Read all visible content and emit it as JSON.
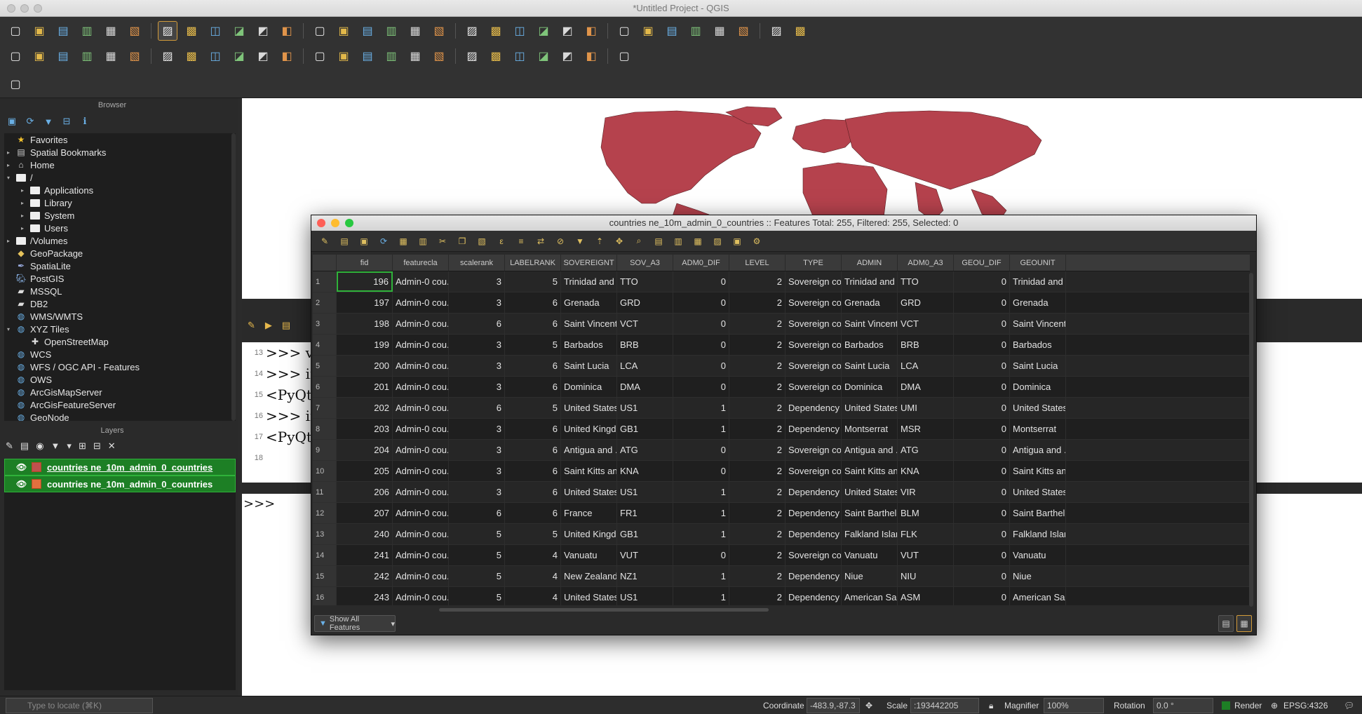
{
  "window": {
    "title": "*Untitled Project - QGIS"
  },
  "toolbar": {
    "row1": [
      "new-project-icon",
      "open-project-icon",
      "save-project-icon",
      "save-as-icon",
      "print-layout-icon",
      "style-manager-icon",
      "pan-icon",
      "pan-to-selection-icon",
      "zoom-in-icon",
      "zoom-out-icon",
      "zoom-full-icon",
      "zoom-to-selection-icon",
      "zoom-to-layer-icon",
      "zoom-native-icon",
      "zoom-last-icon",
      "zoom-next-icon",
      "new-map-view-icon",
      "temporal-icon",
      "bookmark-icon",
      "refresh-icon",
      "identify-icon",
      "actions-icon",
      "select-icon",
      "deselect-icon",
      "attribute-table-icon",
      "field-calc-icon",
      "statistics-icon",
      "processing-icon",
      "sum-icon",
      "measure-icon",
      "annotation-icon",
      "text-annotation-icon"
    ],
    "row2": [
      "add-vector-icon",
      "add-raster-icon",
      "digitize-icon",
      "edit-pencil-icon",
      "save-edits-icon",
      "add-polygon-icon",
      "vertex-tool-icon",
      "delete-icon",
      "cut-icon",
      "copy-icon",
      "paste-icon",
      "undo-icon",
      "redo-icon",
      "label-icon",
      "diagram-icon",
      "label-pin-icon",
      "label-show-icon",
      "label-move-icon",
      "label-rotate-icon",
      "label-change-icon",
      "globe-icon",
      "wms-icon",
      "plugin-icon",
      "python-icon",
      "help-icon"
    ],
    "row3": [
      "gps-icon"
    ]
  },
  "browser": {
    "title": "Browser",
    "items": [
      {
        "label": "Favorites",
        "icon": "star-icon",
        "depth": 0,
        "arrow": ""
      },
      {
        "label": "Spatial Bookmarks",
        "icon": "bookmark-icon",
        "depth": 0,
        "arrow": "▸"
      },
      {
        "label": "Home",
        "icon": "home-icon",
        "depth": 0,
        "arrow": "▸"
      },
      {
        "label": "/",
        "icon": "folder-icon",
        "depth": 0,
        "arrow": "▾"
      },
      {
        "label": "Applications",
        "icon": "folder-icon",
        "depth": 1,
        "arrow": "▸"
      },
      {
        "label": "Library",
        "icon": "folder-icon",
        "depth": 1,
        "arrow": "▸"
      },
      {
        "label": "System",
        "icon": "folder-icon",
        "depth": 1,
        "arrow": "▸"
      },
      {
        "label": "Users",
        "icon": "folder-icon",
        "depth": 1,
        "arrow": "▸"
      },
      {
        "label": "/Volumes",
        "icon": "folder-icon",
        "depth": 0,
        "arrow": "▸"
      },
      {
        "label": "GeoPackage",
        "icon": "geopackage-icon",
        "depth": 0,
        "arrow": ""
      },
      {
        "label": "SpatiaLite",
        "icon": "spatialite-icon",
        "depth": 0,
        "arrow": ""
      },
      {
        "label": "PostGIS",
        "icon": "postgis-icon",
        "depth": 0,
        "arrow": ""
      },
      {
        "label": "MSSQL",
        "icon": "mssql-icon",
        "depth": 0,
        "arrow": ""
      },
      {
        "label": "DB2",
        "icon": "db2-icon",
        "depth": 0,
        "arrow": ""
      },
      {
        "label": "WMS/WMTS",
        "icon": "wms-icon",
        "depth": 0,
        "arrow": ""
      },
      {
        "label": "XYZ Tiles",
        "icon": "xyz-icon",
        "depth": 0,
        "arrow": "▾"
      },
      {
        "label": "OpenStreetMap",
        "icon": "tile-icon",
        "depth": 1,
        "arrow": ""
      },
      {
        "label": "WCS",
        "icon": "wcs-icon",
        "depth": 0,
        "arrow": ""
      },
      {
        "label": "WFS / OGC API - Features",
        "icon": "wfs-icon",
        "depth": 0,
        "arrow": ""
      },
      {
        "label": "OWS",
        "icon": "ows-icon",
        "depth": 0,
        "arrow": ""
      },
      {
        "label": "ArcGisMapServer",
        "icon": "arcgis-icon",
        "depth": 0,
        "arrow": ""
      },
      {
        "label": "ArcGisFeatureServer",
        "icon": "arcgis-icon",
        "depth": 0,
        "arrow": ""
      },
      {
        "label": "GeoNode",
        "icon": "geonode-icon",
        "depth": 0,
        "arrow": ""
      }
    ]
  },
  "layers": {
    "title": "Layers",
    "items": [
      {
        "label": "countries ne_10m_admin_0_countries",
        "symbol": "#c0504e",
        "underline": true
      },
      {
        "label": "countries ne_10m_admin_0_countries",
        "symbol": "#e2703e",
        "underline": false
      }
    ]
  },
  "console": {
    "lines": [
      {
        "no": "13",
        "text": ">>> vla"
      },
      {
        "no": "14",
        "text": ">>> ifa"
      },
      {
        "no": "15",
        "text": "<PyQt5"
      },
      {
        "no": "16",
        "text": ">>> ifa"
      },
      {
        "no": "17",
        "text": "<PyQt5"
      },
      {
        "no": "18",
        "text": ""
      }
    ],
    "prompt": ">>>"
  },
  "attribute_table": {
    "title": "countries ne_10m_admin_0_countries :: Features Total: 255, Filtered: 255, Selected: 0",
    "columns": [
      "fid",
      "featurecla",
      "scalerank",
      "LABELRANK",
      "SOVEREIGNT",
      "SOV_A3",
      "ADM0_DIF",
      "LEVEL",
      "TYPE",
      "ADMIN",
      "ADM0_A3",
      "GEOU_DIF",
      "GEOUNIT"
    ],
    "rows": [
      [
        "1",
        "196",
        "Admin-0 cou...",
        "3",
        "5",
        "Trinidad and ...",
        "TTO",
        "0",
        "2",
        "Sovereign co...",
        "Trinidad and ...",
        "TTO",
        "0",
        "Trinidad and ..."
      ],
      [
        "2",
        "197",
        "Admin-0 cou...",
        "3",
        "6",
        "Grenada",
        "GRD",
        "0",
        "2",
        "Sovereign co...",
        "Grenada",
        "GRD",
        "0",
        "Grenada"
      ],
      [
        "3",
        "198",
        "Admin-0 cou...",
        "6",
        "6",
        "Saint Vincent ...",
        "VCT",
        "0",
        "2",
        "Sovereign co...",
        "Saint Vincent ...",
        "VCT",
        "0",
        "Saint Vincent ..."
      ],
      [
        "4",
        "199",
        "Admin-0 cou...",
        "3",
        "5",
        "Barbados",
        "BRB",
        "0",
        "2",
        "Sovereign co...",
        "Barbados",
        "BRB",
        "0",
        "Barbados"
      ],
      [
        "5",
        "200",
        "Admin-0 cou...",
        "3",
        "6",
        "Saint Lucia",
        "LCA",
        "0",
        "2",
        "Sovereign co...",
        "Saint Lucia",
        "LCA",
        "0",
        "Saint Lucia"
      ],
      [
        "6",
        "201",
        "Admin-0 cou...",
        "3",
        "6",
        "Dominica",
        "DMA",
        "0",
        "2",
        "Sovereign co...",
        "Dominica",
        "DMA",
        "0",
        "Dominica"
      ],
      [
        "7",
        "202",
        "Admin-0 cou...",
        "6",
        "5",
        "United States...",
        "US1",
        "1",
        "2",
        "Dependency",
        "United States...",
        "UMI",
        "0",
        "United States..."
      ],
      [
        "8",
        "203",
        "Admin-0 cou...",
        "3",
        "6",
        "United Kingd...",
        "GB1",
        "1",
        "2",
        "Dependency",
        "Montserrat",
        "MSR",
        "0",
        "Montserrat"
      ],
      [
        "9",
        "204",
        "Admin-0 cou...",
        "3",
        "6",
        "Antigua and ...",
        "ATG",
        "0",
        "2",
        "Sovereign co...",
        "Antigua and ...",
        "ATG",
        "0",
        "Antigua and ..."
      ],
      [
        "10",
        "205",
        "Admin-0 cou...",
        "3",
        "6",
        "Saint Kitts an...",
        "KNA",
        "0",
        "2",
        "Sovereign co...",
        "Saint Kitts an...",
        "KNA",
        "0",
        "Saint Kitts an..."
      ],
      [
        "11",
        "206",
        "Admin-0 cou...",
        "3",
        "6",
        "United States...",
        "US1",
        "1",
        "2",
        "Dependency",
        "United States...",
        "VIR",
        "0",
        "United States..."
      ],
      [
        "12",
        "207",
        "Admin-0 cou...",
        "6",
        "6",
        "France",
        "FR1",
        "1",
        "2",
        "Dependency",
        "Saint Barthel...",
        "BLM",
        "0",
        "Saint Barthel..."
      ],
      [
        "13",
        "240",
        "Admin-0 cou...",
        "5",
        "5",
        "United Kingd...",
        "GB1",
        "1",
        "2",
        "Dependency",
        "Falkland Islan...",
        "FLK",
        "0",
        "Falkland Islan..."
      ],
      [
        "14",
        "241",
        "Admin-0 cou...",
        "5",
        "4",
        "Vanuatu",
        "VUT",
        "0",
        "2",
        "Sovereign co...",
        "Vanuatu",
        "VUT",
        "0",
        "Vanuatu"
      ],
      [
        "15",
        "242",
        "Admin-0 cou...",
        "5",
        "4",
        "New Zealand",
        "NZ1",
        "1",
        "2",
        "Dependency",
        "Niue",
        "NIU",
        "0",
        "Niue"
      ],
      [
        "16",
        "243",
        "Admin-0 cou...",
        "5",
        "4",
        "United States...",
        "US1",
        "1",
        "2",
        "Dependency",
        "American Sa...",
        "ASM",
        "0",
        "American Sa..."
      ]
    ],
    "filter_button": "Show All Features"
  },
  "statusbar": {
    "locator_placeholder": "Type to locate (⌘K)",
    "coordinate_label": "Coordinate",
    "coordinate_value": "-483.9,-87.3",
    "scale_label": "Scale",
    "scale_value": ":193442205",
    "magnifier_label": "Magnifier",
    "magnifier_value": "100%",
    "rotation_label": "Rotation",
    "rotation_value": "0.0 °",
    "render_label": "Render",
    "crs": "EPSG:4326"
  },
  "colors": {
    "map_fill": "#b5424d",
    "layer_highlight": "#1d7f25",
    "accent": "#d29b3a"
  }
}
